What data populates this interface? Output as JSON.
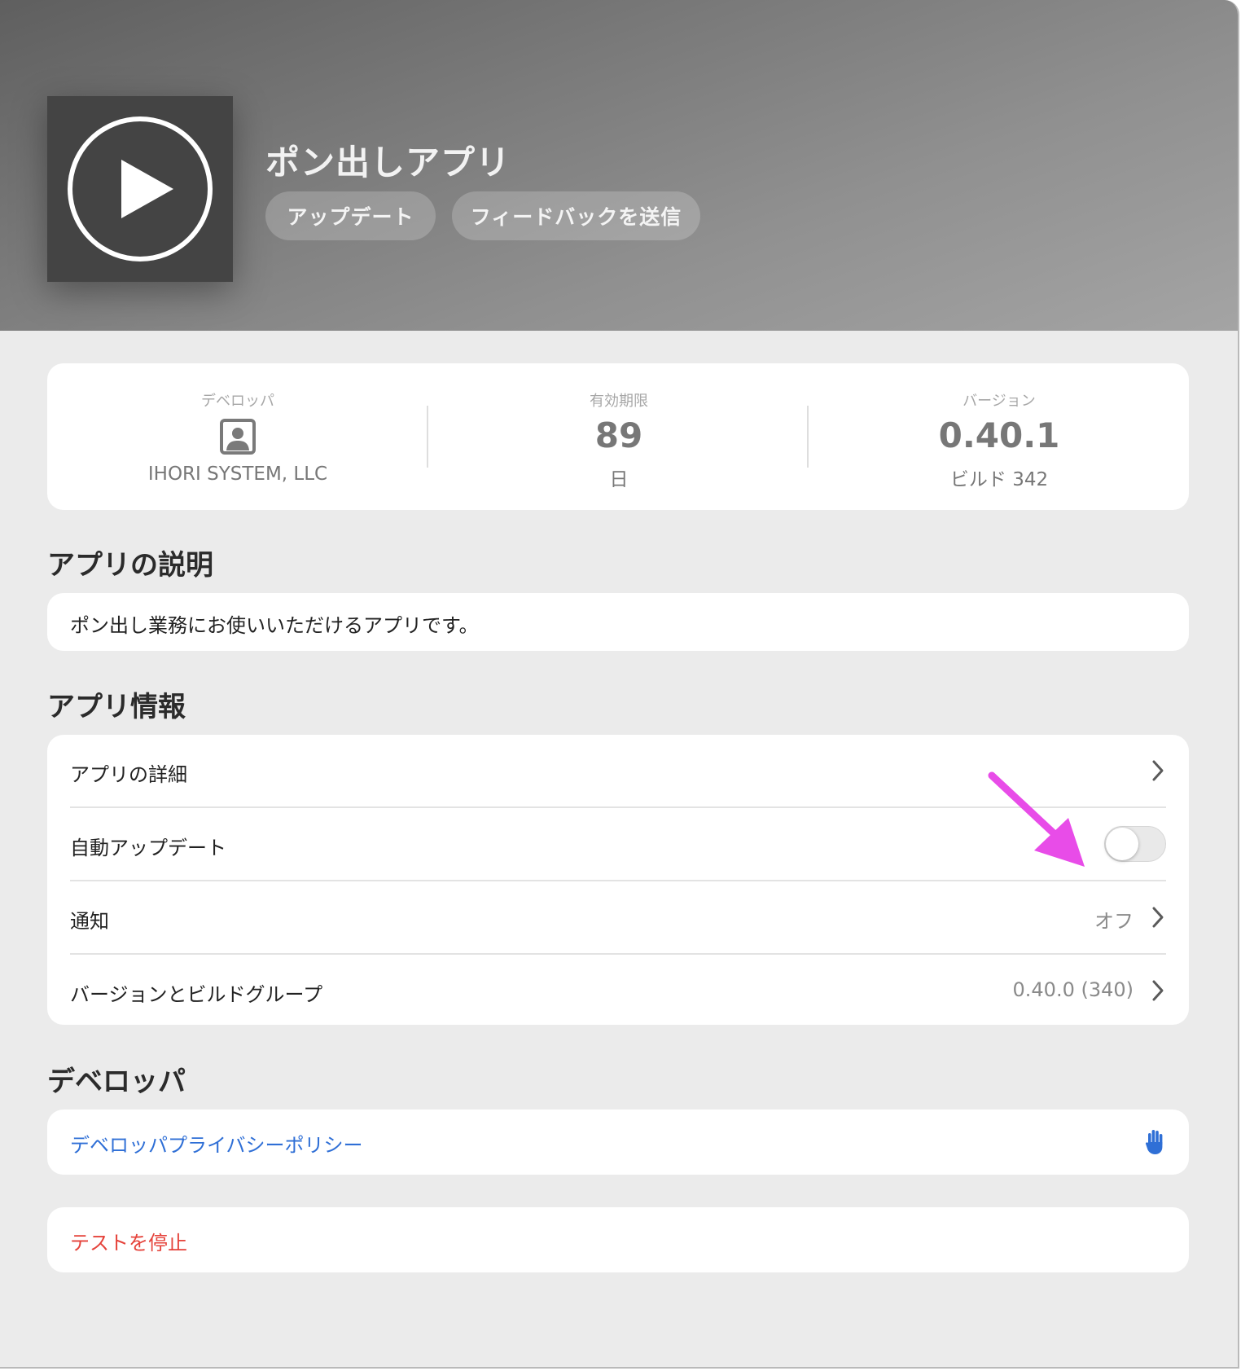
{
  "app": {
    "title": "ポン出しアプリ",
    "update_label": "アップデート",
    "feedback_label": "フィードバックを送信"
  },
  "stats": {
    "developer": {
      "label": "デベロッパ",
      "icon": "person-square-icon",
      "value": "IHORI SYSTEM, LLC"
    },
    "expiry": {
      "label": "有効期限",
      "value": "89",
      "unit": "日"
    },
    "version": {
      "label": "バージョン",
      "value": "0.40.1",
      "build": "ビルド 342"
    }
  },
  "description": {
    "heading": "アプリの説明",
    "text": "ポン出し業務にお使いいただけるアプリです。"
  },
  "app_info": {
    "heading": "アプリ情報",
    "rows": [
      {
        "label": "アプリの詳細",
        "value": "",
        "type": "link"
      },
      {
        "label": "自動アップデート",
        "value": "",
        "type": "toggle",
        "toggle_on": false
      },
      {
        "label": "通知",
        "value": "オフ",
        "type": "link"
      },
      {
        "label": "バージョンとビルドグループ",
        "value": "0.40.0 (340)",
        "type": "link"
      }
    ]
  },
  "developer_section": {
    "heading": "デベロッパ",
    "privacy_label": "デベロッパプライバシーポリシー",
    "privacy_icon": "hand-raised-icon"
  },
  "stop_testing_label": "テストを停止",
  "colors": {
    "link_blue": "#2f6fd6",
    "destructive_red": "#e5423a",
    "annotation_arrow": "#e84ce8"
  }
}
